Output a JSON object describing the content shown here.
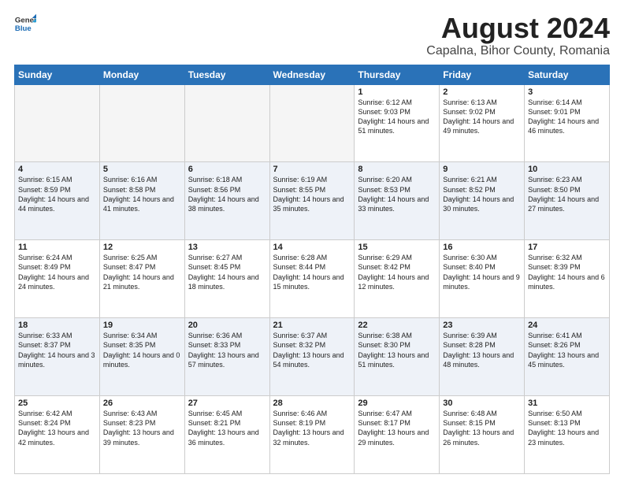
{
  "header": {
    "logo_general": "General",
    "logo_blue": "Blue",
    "title": "August 2024",
    "subtitle": "Capalna, Bihor County, Romania"
  },
  "weekdays": [
    "Sunday",
    "Monday",
    "Tuesday",
    "Wednesday",
    "Thursday",
    "Friday",
    "Saturday"
  ],
  "weeks": [
    [
      {
        "day": "",
        "empty": true
      },
      {
        "day": "",
        "empty": true
      },
      {
        "day": "",
        "empty": true
      },
      {
        "day": "",
        "empty": true
      },
      {
        "day": "1",
        "sunrise": "Sunrise: 6:12 AM",
        "sunset": "Sunset: 9:03 PM",
        "daylight": "Daylight: 14 hours and 51 minutes."
      },
      {
        "day": "2",
        "sunrise": "Sunrise: 6:13 AM",
        "sunset": "Sunset: 9:02 PM",
        "daylight": "Daylight: 14 hours and 49 minutes."
      },
      {
        "day": "3",
        "sunrise": "Sunrise: 6:14 AM",
        "sunset": "Sunset: 9:01 PM",
        "daylight": "Daylight: 14 hours and 46 minutes."
      }
    ],
    [
      {
        "day": "4",
        "sunrise": "Sunrise: 6:15 AM",
        "sunset": "Sunset: 8:59 PM",
        "daylight": "Daylight: 14 hours and 44 minutes."
      },
      {
        "day": "5",
        "sunrise": "Sunrise: 6:16 AM",
        "sunset": "Sunset: 8:58 PM",
        "daylight": "Daylight: 14 hours and 41 minutes."
      },
      {
        "day": "6",
        "sunrise": "Sunrise: 6:18 AM",
        "sunset": "Sunset: 8:56 PM",
        "daylight": "Daylight: 14 hours and 38 minutes."
      },
      {
        "day": "7",
        "sunrise": "Sunrise: 6:19 AM",
        "sunset": "Sunset: 8:55 PM",
        "daylight": "Daylight: 14 hours and 35 minutes."
      },
      {
        "day": "8",
        "sunrise": "Sunrise: 6:20 AM",
        "sunset": "Sunset: 8:53 PM",
        "daylight": "Daylight: 14 hours and 33 minutes."
      },
      {
        "day": "9",
        "sunrise": "Sunrise: 6:21 AM",
        "sunset": "Sunset: 8:52 PM",
        "daylight": "Daylight: 14 hours and 30 minutes."
      },
      {
        "day": "10",
        "sunrise": "Sunrise: 6:23 AM",
        "sunset": "Sunset: 8:50 PM",
        "daylight": "Daylight: 14 hours and 27 minutes."
      }
    ],
    [
      {
        "day": "11",
        "sunrise": "Sunrise: 6:24 AM",
        "sunset": "Sunset: 8:49 PM",
        "daylight": "Daylight: 14 hours and 24 minutes."
      },
      {
        "day": "12",
        "sunrise": "Sunrise: 6:25 AM",
        "sunset": "Sunset: 8:47 PM",
        "daylight": "Daylight: 14 hours and 21 minutes."
      },
      {
        "day": "13",
        "sunrise": "Sunrise: 6:27 AM",
        "sunset": "Sunset: 8:45 PM",
        "daylight": "Daylight: 14 hours and 18 minutes."
      },
      {
        "day": "14",
        "sunrise": "Sunrise: 6:28 AM",
        "sunset": "Sunset: 8:44 PM",
        "daylight": "Daylight: 14 hours and 15 minutes."
      },
      {
        "day": "15",
        "sunrise": "Sunrise: 6:29 AM",
        "sunset": "Sunset: 8:42 PM",
        "daylight": "Daylight: 14 hours and 12 minutes."
      },
      {
        "day": "16",
        "sunrise": "Sunrise: 6:30 AM",
        "sunset": "Sunset: 8:40 PM",
        "daylight": "Daylight: 14 hours and 9 minutes."
      },
      {
        "day": "17",
        "sunrise": "Sunrise: 6:32 AM",
        "sunset": "Sunset: 8:39 PM",
        "daylight": "Daylight: 14 hours and 6 minutes."
      }
    ],
    [
      {
        "day": "18",
        "sunrise": "Sunrise: 6:33 AM",
        "sunset": "Sunset: 8:37 PM",
        "daylight": "Daylight: 14 hours and 3 minutes."
      },
      {
        "day": "19",
        "sunrise": "Sunrise: 6:34 AM",
        "sunset": "Sunset: 8:35 PM",
        "daylight": "Daylight: 14 hours and 0 minutes."
      },
      {
        "day": "20",
        "sunrise": "Sunrise: 6:36 AM",
        "sunset": "Sunset: 8:33 PM",
        "daylight": "Daylight: 13 hours and 57 minutes."
      },
      {
        "day": "21",
        "sunrise": "Sunrise: 6:37 AM",
        "sunset": "Sunset: 8:32 PM",
        "daylight": "Daylight: 13 hours and 54 minutes."
      },
      {
        "day": "22",
        "sunrise": "Sunrise: 6:38 AM",
        "sunset": "Sunset: 8:30 PM",
        "daylight": "Daylight: 13 hours and 51 minutes."
      },
      {
        "day": "23",
        "sunrise": "Sunrise: 6:39 AM",
        "sunset": "Sunset: 8:28 PM",
        "daylight": "Daylight: 13 hours and 48 minutes."
      },
      {
        "day": "24",
        "sunrise": "Sunrise: 6:41 AM",
        "sunset": "Sunset: 8:26 PM",
        "daylight": "Daylight: 13 hours and 45 minutes."
      }
    ],
    [
      {
        "day": "25",
        "sunrise": "Sunrise: 6:42 AM",
        "sunset": "Sunset: 8:24 PM",
        "daylight": "Daylight: 13 hours and 42 minutes."
      },
      {
        "day": "26",
        "sunrise": "Sunrise: 6:43 AM",
        "sunset": "Sunset: 8:23 PM",
        "daylight": "Daylight: 13 hours and 39 minutes."
      },
      {
        "day": "27",
        "sunrise": "Sunrise: 6:45 AM",
        "sunset": "Sunset: 8:21 PM",
        "daylight": "Daylight: 13 hours and 36 minutes."
      },
      {
        "day": "28",
        "sunrise": "Sunrise: 6:46 AM",
        "sunset": "Sunset: 8:19 PM",
        "daylight": "Daylight: 13 hours and 32 minutes."
      },
      {
        "day": "29",
        "sunrise": "Sunrise: 6:47 AM",
        "sunset": "Sunset: 8:17 PM",
        "daylight": "Daylight: 13 hours and 29 minutes."
      },
      {
        "day": "30",
        "sunrise": "Sunrise: 6:48 AM",
        "sunset": "Sunset: 8:15 PM",
        "daylight": "Daylight: 13 hours and 26 minutes."
      },
      {
        "day": "31",
        "sunrise": "Sunrise: 6:50 AM",
        "sunset": "Sunset: 8:13 PM",
        "daylight": "Daylight: 13 hours and 23 minutes."
      }
    ]
  ]
}
